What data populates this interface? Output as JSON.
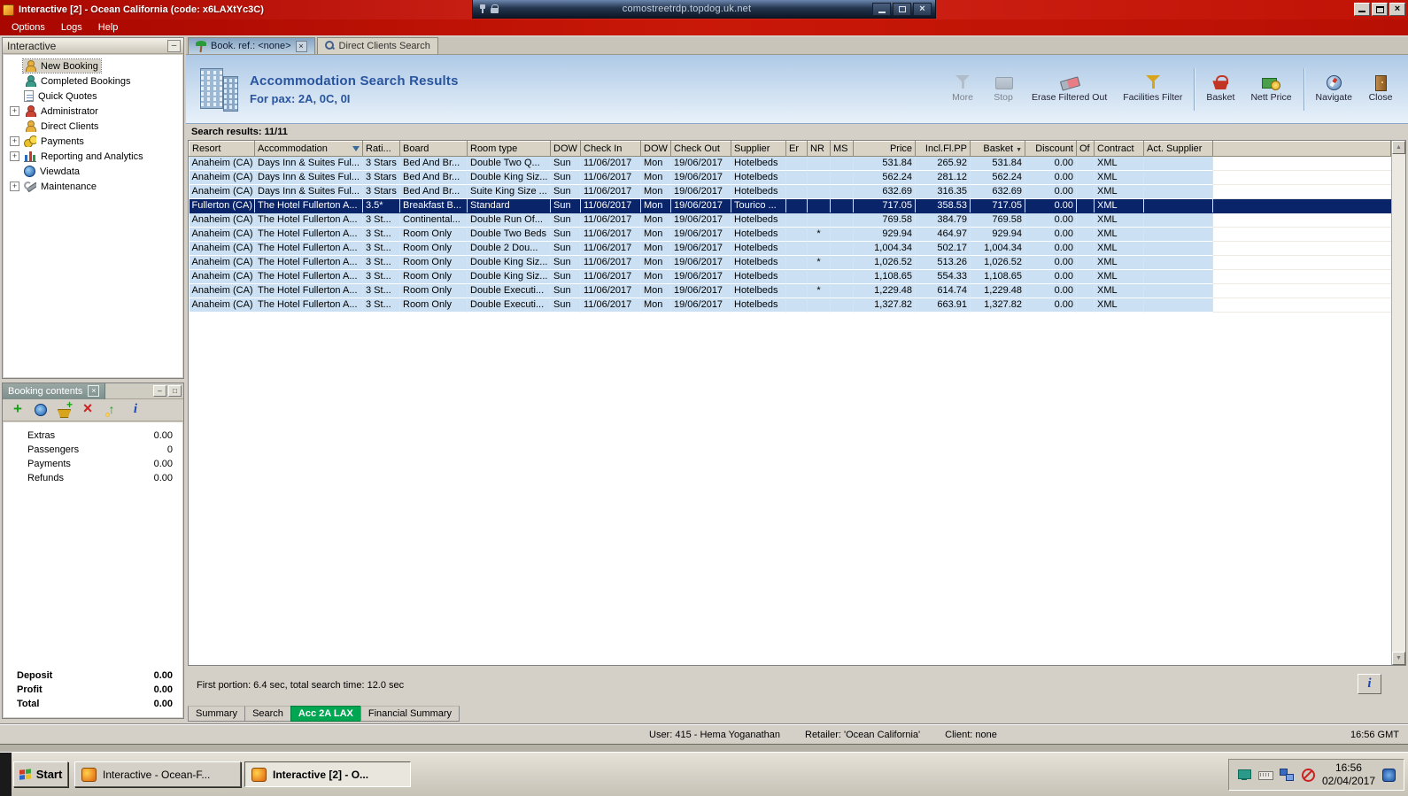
{
  "window": {
    "title": "Interactive [2] - Ocean California (code: x6LAXtYc3C)",
    "menu": [
      "Options",
      "Logs",
      "Help"
    ]
  },
  "rdp_bar": {
    "title": "comostreetrdp.topdog.uk.net",
    "icons": [
      "pin-icon",
      "lock-icon"
    ],
    "controls": [
      "minimize",
      "restore",
      "close"
    ]
  },
  "sidebar": {
    "title": "Interactive",
    "items": [
      {
        "label": "New Booking",
        "icon": "new-booking-icon",
        "expandable": false,
        "selected": true
      },
      {
        "label": "Completed Bookings",
        "icon": "completed-bookings-icon",
        "expandable": false,
        "selected": false
      },
      {
        "label": "Quick Quotes",
        "icon": "quick-quotes-icon",
        "expandable": false,
        "selected": false
      },
      {
        "label": "Administrator",
        "icon": "administrator-icon",
        "expandable": true,
        "selected": false
      },
      {
        "label": "Direct Clients",
        "icon": "direct-clients-icon",
        "expandable": false,
        "selected": false
      },
      {
        "label": "Payments",
        "icon": "payments-icon",
        "expandable": true,
        "selected": false
      },
      {
        "label": "Reporting and Analytics",
        "icon": "reporting-icon",
        "expandable": true,
        "selected": false
      },
      {
        "label": "Viewdata",
        "icon": "viewdata-icon",
        "expandable": false,
        "selected": false
      },
      {
        "label": "Maintenance",
        "icon": "maintenance-icon",
        "expandable": true,
        "selected": false
      }
    ]
  },
  "booking_contents": {
    "title": "Booking contents",
    "toolbar_icons": [
      "add-icon",
      "globe-icon",
      "basket-add-icon",
      "delete-icon",
      "export-icon",
      "info-icon"
    ],
    "rows": [
      {
        "label": "Extras",
        "value": "0.00"
      },
      {
        "label": "Passengers",
        "value": "0"
      },
      {
        "label": "Payments",
        "value": "0.00"
      },
      {
        "label": "Refunds",
        "value": "0.00"
      }
    ],
    "totals": [
      {
        "label": "Deposit",
        "value": "0.00"
      },
      {
        "label": "Profit",
        "value": "0.00"
      },
      {
        "label": "Total",
        "value": "0.00"
      }
    ]
  },
  "main": {
    "tabs": [
      {
        "label": "Book. ref.: <none>",
        "icon": "palm-icon",
        "active": true,
        "closable": true
      },
      {
        "label": "Direct Clients Search",
        "icon": "clients-search-icon",
        "active": false
      }
    ],
    "header": {
      "icon": "hotel-building-icon",
      "title": "Accommodation Search Results",
      "subtitle": "For pax: 2A, 0C, 0I"
    },
    "toolbar": [
      {
        "label": "More",
        "icon": "more-icon",
        "disabled": true
      },
      {
        "label": "Stop",
        "icon": "stop-icon",
        "disabled": true
      },
      {
        "label": "Erase Filtered Out",
        "icon": "eraser-icon",
        "disabled": false
      },
      {
        "label": "Facilities Filter",
        "icon": "facilities-filter-icon",
        "disabled": false
      },
      {
        "label": "Basket",
        "icon": "basket-icon",
        "disabled": false,
        "separator_before": true
      },
      {
        "label": "Nett Price",
        "icon": "nett-price-icon",
        "disabled": false
      },
      {
        "label": "Navigate",
        "icon": "navigate-icon",
        "disabled": false,
        "separator_before": true
      },
      {
        "label": "Close",
        "icon": "close-icon",
        "disabled": false
      }
    ],
    "results_label": "Search results: 11/11",
    "table": {
      "headers": [
        {
          "label": "Resort"
        },
        {
          "label": "Accommodation",
          "filter_icon": true
        },
        {
          "label": "Rati..."
        },
        {
          "label": "Board"
        },
        {
          "label": "Room type"
        },
        {
          "label": "DOW"
        },
        {
          "label": "Check In"
        },
        {
          "label": "DOW"
        },
        {
          "label": "Check Out"
        },
        {
          "label": "Supplier"
        },
        {
          "label": "Er"
        },
        {
          "label": "NR"
        },
        {
          "label": "MS"
        },
        {
          "label": "Price"
        },
        {
          "label": "Incl.Fl.PP"
        },
        {
          "label": "Basket",
          "sort_icon": true
        },
        {
          "label": "Discount"
        },
        {
          "label": "Of"
        },
        {
          "label": "Contract"
        },
        {
          "label": "Act. Supplier"
        }
      ],
      "selected_row": 3,
      "rows": [
        [
          "Anaheim (CA)",
          "Days Inn & Suites Ful...",
          "3 Stars",
          "Bed And Br...",
          "Double Two Q...",
          "Sun",
          "11/06/2017",
          "Mon",
          "19/06/2017",
          "Hotelbeds",
          "",
          "",
          "",
          "531.84",
          "265.92",
          "531.84",
          "0.00",
          "",
          "XML",
          ""
        ],
        [
          "Anaheim (CA)",
          "Days Inn & Suites Ful...",
          "3 Stars",
          "Bed And Br...",
          "Double King Siz...",
          "Sun",
          "11/06/2017",
          "Mon",
          "19/06/2017",
          "Hotelbeds",
          "",
          "",
          "",
          "562.24",
          "281.12",
          "562.24",
          "0.00",
          "",
          "XML",
          ""
        ],
        [
          "Anaheim (CA)",
          "Days Inn & Suites Ful...",
          "3 Stars",
          "Bed And Br...",
          "Suite King Size ...",
          "Sun",
          "11/06/2017",
          "Mon",
          "19/06/2017",
          "Hotelbeds",
          "",
          "",
          "",
          "632.69",
          "316.35",
          "632.69",
          "0.00",
          "",
          "XML",
          ""
        ],
        [
          "Fullerton (CA)",
          "The Hotel Fullerton A...",
          "3.5*",
          "Breakfast B...",
          "Standard",
          "Sun",
          "11/06/2017",
          "Mon",
          "19/06/2017",
          "Tourico ...",
          "",
          "",
          "",
          "717.05",
          "358.53",
          "717.05",
          "0.00",
          "",
          "XML",
          ""
        ],
        [
          "Anaheim (CA)",
          "The Hotel Fullerton A...",
          "3 St...",
          "Continental...",
          "Double Run Of...",
          "Sun",
          "11/06/2017",
          "Mon",
          "19/06/2017",
          "Hotelbeds",
          "",
          "",
          "",
          "769.58",
          "384.79",
          "769.58",
          "0.00",
          "",
          "XML",
          ""
        ],
        [
          "Anaheim (CA)",
          "The Hotel Fullerton A...",
          "3 St...",
          "Room Only",
          "Double Two Beds",
          "Sun",
          "11/06/2017",
          "Mon",
          "19/06/2017",
          "Hotelbeds",
          "",
          "*",
          "",
          "929.94",
          "464.97",
          "929.94",
          "0.00",
          "",
          "XML",
          ""
        ],
        [
          "Anaheim (CA)",
          "The Hotel Fullerton A...",
          "3 St...",
          "Room Only",
          "Double 2 Dou...",
          "Sun",
          "11/06/2017",
          "Mon",
          "19/06/2017",
          "Hotelbeds",
          "",
          "",
          "",
          "1,004.34",
          "502.17",
          "1,004.34",
          "0.00",
          "",
          "XML",
          ""
        ],
        [
          "Anaheim (CA)",
          "The Hotel Fullerton A...",
          "3 St...",
          "Room Only",
          "Double King Siz...",
          "Sun",
          "11/06/2017",
          "Mon",
          "19/06/2017",
          "Hotelbeds",
          "",
          "*",
          "",
          "1,026.52",
          "513.26",
          "1,026.52",
          "0.00",
          "",
          "XML",
          ""
        ],
        [
          "Anaheim (CA)",
          "The Hotel Fullerton A...",
          "3 St...",
          "Room Only",
          "Double King Siz...",
          "Sun",
          "11/06/2017",
          "Mon",
          "19/06/2017",
          "Hotelbeds",
          "",
          "",
          "",
          "1,108.65",
          "554.33",
          "1,108.65",
          "0.00",
          "",
          "XML",
          ""
        ],
        [
          "Anaheim (CA)",
          "The Hotel Fullerton A...",
          "3 St...",
          "Room Only",
          "Double Executi...",
          "Sun",
          "11/06/2017",
          "Mon",
          "19/06/2017",
          "Hotelbeds",
          "",
          "*",
          "",
          "1,229.48",
          "614.74",
          "1,229.48",
          "0.00",
          "",
          "XML",
          ""
        ],
        [
          "Anaheim (CA)",
          "The Hotel Fullerton A...",
          "3 St...",
          "Room Only",
          "Double Executi...",
          "Sun",
          "11/06/2017",
          "Mon",
          "19/06/2017",
          "Hotelbeds",
          "",
          "",
          "",
          "1,327.82",
          "663.91",
          "1,327.82",
          "0.00",
          "",
          "XML",
          ""
        ]
      ]
    },
    "footer": "First portion: 6.4 sec, total search time: 12.0 sec",
    "bottom_tabs": [
      {
        "label": "Summary",
        "active": false
      },
      {
        "label": "Search",
        "active": false
      },
      {
        "label": "Acc 2A LAX",
        "active": true
      },
      {
        "label": "Financial Summary",
        "active": false
      }
    ]
  },
  "statusbar": {
    "user": "User: 415 - Hema Yoganathan",
    "retailer": "Retailer: 'Ocean California'",
    "client": "Client: none",
    "time": "16:56 GMT"
  },
  "taskbar": {
    "start_label": "Start",
    "tasks": [
      {
        "label": "Interactive - Ocean-F...",
        "icon": "interactive-app-icon",
        "active": false
      },
      {
        "label": "Interactive [2] - O...",
        "icon": "interactive-app-icon",
        "active": true
      }
    ],
    "tray_icons": [
      "display-icon",
      "keyboard-icon",
      "network-icon",
      "blocked-icon"
    ],
    "clock": "16:56",
    "date": "02/04/2017",
    "corner_icon": "security-icon"
  },
  "colors": {
    "titlebar_red": "#c41000",
    "selected_row": "#0a246a",
    "row_blue": "#cbe0f3",
    "accent_blue": "#29549e",
    "active_tab_green": "#00a651",
    "table_header": "#d8d3c4"
  }
}
